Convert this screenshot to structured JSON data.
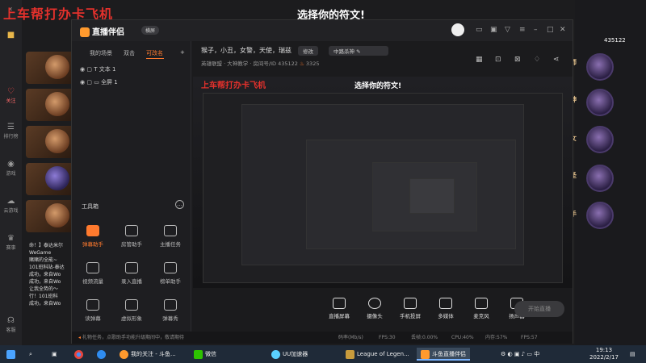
{
  "background_page": {
    "red_title": "上车帮打办卡飞机",
    "big_title": "选择你的符文!",
    "left_nav": [
      {
        "icon": "heart-icon",
        "label": "关注"
      },
      {
        "icon": "list-icon",
        "label": "排行榜"
      },
      {
        "icon": "gamepad-icon",
        "label": "游戏"
      },
      {
        "icon": "cloud-game-icon",
        "label": "云游戏"
      },
      {
        "icon": "trophy-icon",
        "label": "赛事"
      },
      {
        "icon": "headset-icon",
        "label": "客服"
      }
    ],
    "right_labels": [
      "师",
      "神",
      "女",
      "圣",
      "手"
    ],
    "room_number": "435122",
    "chat_lines": [
      "命！】泰达米尔",
      "WeGame",
      "赌赌的全能~",
      "101班科站-泰达",
      "成功，来自Wo",
      "成功，来自Wo",
      "让我全势的～",
      "行！101班科",
      "成功，来自Wo"
    ]
  },
  "app": {
    "name": "直播伴侣",
    "mode_badge": "横屏",
    "left_tabs": [
      "我的场景",
      "双击",
      "可改名"
    ],
    "active_tab": 2,
    "sources": [
      "文本 1",
      "全屏 1"
    ],
    "toolbox_title": "工具箱",
    "tools": [
      {
        "label": "弹幕助手",
        "icon": "danmaku-icon",
        "active": true
      },
      {
        "label": "房管助手",
        "icon": "room-admin-icon",
        "active": false
      },
      {
        "label": "主播任务",
        "icon": "task-icon",
        "active": false
      },
      {
        "label": "视频流量",
        "icon": "video-flow-icon",
        "active": false
      },
      {
        "label": "录入直播",
        "icon": "record-icon",
        "active": false
      },
      {
        "label": "榜单助手",
        "icon": "ranking-icon",
        "active": false
      },
      {
        "label": "读弹幕",
        "icon": "read-danmaku-icon",
        "active": false
      },
      {
        "label": "虚拟形象",
        "icon": "avatar-icon",
        "active": false
      },
      {
        "label": "弹幕秀",
        "icon": "danmaku-show-icon",
        "active": false
      }
    ],
    "room_title": "猴子，小丑，女警，天使，瑞兹",
    "edit_label": "修改",
    "category": "中路杀神",
    "game": "英雄联盟 · 大神教学",
    "room_id_label": "房间号/ID",
    "room_id": "435122",
    "heat_value": "3325",
    "controls": [
      {
        "label": "直播屏幕",
        "icon": "screen-icon"
      },
      {
        "label": "摄像头",
        "icon": "camera-icon"
      },
      {
        "label": "手机投屏",
        "icon": "phone-cast-icon"
      },
      {
        "label": "多媒体",
        "icon": "media-icon"
      },
      {
        "label": "麦克风",
        "icon": "mic-icon"
      },
      {
        "label": "扬声器",
        "icon": "speaker-icon"
      }
    ],
    "go_live_label": "开始直播",
    "status_message": "礼物任务，点歌助手功能升级期间中，敬请期待",
    "status_stats": [
      "码率(Mb/s)",
      "FPS:30",
      "丢帧:0.00%",
      "CPU:40%",
      "内存:57%",
      "FPS:57"
    ]
  },
  "taskbar": {
    "items": [
      {
        "label": "",
        "icon": "windows-icon"
      },
      {
        "label": "",
        "icon": "search-icon"
      },
      {
        "label": "",
        "icon": "task-view-icon"
      },
      {
        "label": "",
        "icon": "chrome-icon"
      },
      {
        "label": "",
        "icon": "edge-icon"
      },
      {
        "label": "我的关注 - 斗鱼...",
        "icon": "browser-icon"
      },
      {
        "label": "微信",
        "icon": "wechat-icon"
      },
      {
        "label": "UU加速器",
        "icon": "uu-icon"
      },
      {
        "label": "League of Legen...",
        "icon": "lol-icon"
      },
      {
        "label": "斗鱼直播伴侣",
        "icon": "douyu-icon"
      }
    ],
    "time": "19:13",
    "date": "2022/2/17"
  },
  "colors": {
    "accent": "#ff7a2e",
    "red_title": "#e4312c"
  }
}
